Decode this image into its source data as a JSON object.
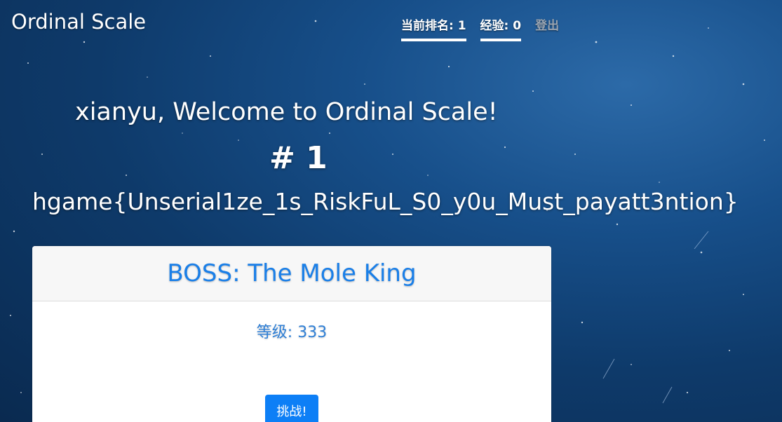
{
  "brand": "Ordinal Scale",
  "nav": {
    "rank_label": "当前排名: 1",
    "exp_label": "经验: 0",
    "logout_label": "登出"
  },
  "main": {
    "welcome": "xianyu, Welcome to Ordinal Scale!",
    "rank": "# 1",
    "flag": "hgame{Unserial1ze_1s_RiskFuL_S0_y0u_Must_payatt3ntion}"
  },
  "boss_card": {
    "title": "BOSS: The Mole King",
    "level": "等级: 333",
    "challenge_label": "挑战!"
  }
}
